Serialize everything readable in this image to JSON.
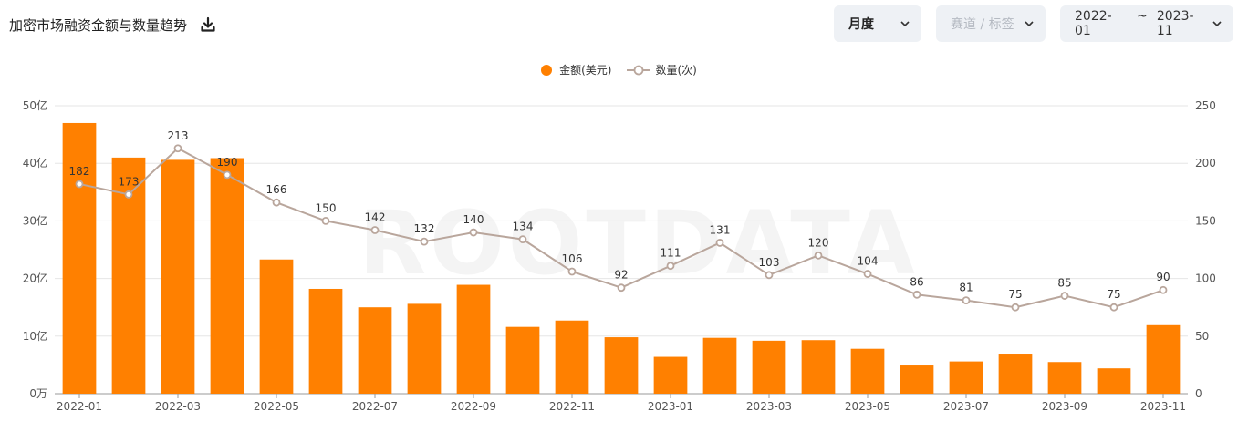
{
  "header": {
    "title": "加密市场融资金额与数量趋势",
    "period_select": "月度",
    "track_select": "赛道 / 标签",
    "range_start": "2022-01",
    "range_sep": "~",
    "range_end": "2023-11"
  },
  "colors": {
    "bar": "#ff8000",
    "line": "#b9a69c",
    "grid": "#e6e6e6"
  },
  "watermark": "ROOTDATA",
  "chart_data": {
    "type": "bar",
    "categories": [
      "2022-01",
      "2022-02",
      "2022-03",
      "2022-04",
      "2022-05",
      "2022-06",
      "2022-07",
      "2022-08",
      "2022-09",
      "2022-10",
      "2022-11",
      "2022-12",
      "2023-01",
      "2023-02",
      "2023-03",
      "2023-04",
      "2023-05",
      "2023-06",
      "2023-07",
      "2023-08",
      "2023-09",
      "2023-10",
      "2023-11"
    ],
    "x_tick_labels": [
      "2022-01",
      "2022-03",
      "2022-05",
      "2022-07",
      "2022-09",
      "2022-11",
      "2023-01",
      "2023-03",
      "2023-05",
      "2023-07",
      "2023-09",
      "2023-11"
    ],
    "series": [
      {
        "name": "金额(美元)",
        "type": "bar",
        "axis": "left",
        "values": [
          47,
          41,
          40.6,
          40.9,
          23.3,
          18.2,
          15,
          15.6,
          18.9,
          11.6,
          12.7,
          9.8,
          6.4,
          9.7,
          9.2,
          9.3,
          7.8,
          4.9,
          5.6,
          6.8,
          5.5,
          4.4,
          11.9
        ]
      },
      {
        "name": "数量(次)",
        "type": "line",
        "axis": "right",
        "values": [
          182,
          173,
          213,
          190,
          166,
          150,
          142,
          132,
          140,
          134,
          106,
          92,
          111,
          131,
          103,
          120,
          104,
          86,
          81,
          75,
          85,
          75,
          90
        ]
      }
    ],
    "y_left": {
      "ylim": [
        0,
        50
      ],
      "ticks": [
        "0万",
        "10亿",
        "20亿",
        "30亿",
        "40亿",
        "50亿"
      ]
    },
    "y_right": {
      "ylim": [
        0,
        250
      ],
      "ticks": [
        "0",
        "50",
        "100",
        "150",
        "200",
        "250"
      ]
    },
    "grid": true,
    "legend": "top-center"
  }
}
